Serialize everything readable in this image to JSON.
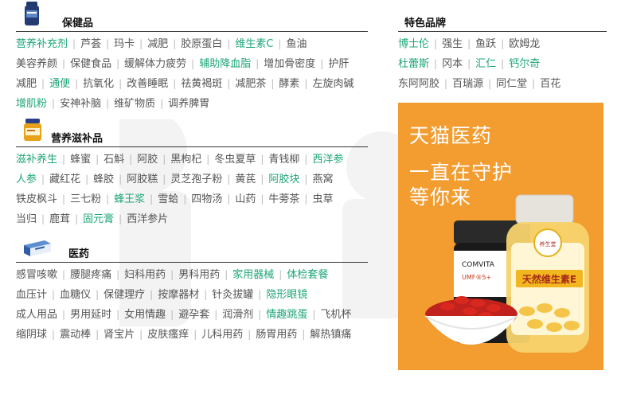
{
  "sections": [
    {
      "title": "保健品",
      "icon": "supplement-bottle-icon",
      "rows": [
        [
          {
            "t": "营养补充剂",
            "hl": true
          },
          {
            "t": "芦荟"
          },
          {
            "t": "玛卡"
          },
          {
            "t": "减肥"
          },
          {
            "t": "胶原蛋白"
          },
          {
            "t": "维生素C",
            "hl": true
          },
          {
            "t": "鱼油"
          }
        ],
        [
          {
            "t": "美容养颜"
          },
          {
            "t": "保健食品"
          },
          {
            "t": "缓解体力疲劳"
          },
          {
            "t": "辅助降血脂",
            "hl": true
          },
          {
            "t": "增加骨密度"
          },
          {
            "t": "护肝"
          }
        ],
        [
          {
            "t": "减肥"
          },
          {
            "t": "通便",
            "hl": true
          },
          {
            "t": "抗氧化"
          },
          {
            "t": "改善睡眠"
          },
          {
            "t": "祛黄褐斑"
          },
          {
            "t": "减肥茶"
          },
          {
            "t": "酵素"
          },
          {
            "t": "左旋肉碱"
          }
        ],
        [
          {
            "t": "增肌粉",
            "hl": true
          },
          {
            "t": "安神补脑"
          },
          {
            "t": "维矿物质"
          },
          {
            "t": "调养脾胃"
          }
        ]
      ]
    },
    {
      "title": "营养滋补品",
      "icon": "nutrition-jar-icon",
      "rows": [
        [
          {
            "t": "滋补养生",
            "hl": true
          },
          {
            "t": "蜂蜜"
          },
          {
            "t": "石斛"
          },
          {
            "t": "阿胶"
          },
          {
            "t": "黑枸杞"
          },
          {
            "t": "冬虫夏草"
          },
          {
            "t": "青钱柳"
          },
          {
            "t": "西洋参",
            "hl": true
          }
        ],
        [
          {
            "t": "人参",
            "hl": true
          },
          {
            "t": "藏红花"
          },
          {
            "t": "蜂胶"
          },
          {
            "t": "阿胶糕"
          },
          {
            "t": "灵芝孢子粉"
          },
          {
            "t": "黄芪"
          },
          {
            "t": "阿胶块",
            "hl": true
          },
          {
            "t": "燕窝"
          }
        ],
        [
          {
            "t": "铁皮枫斗"
          },
          {
            "t": "三七粉"
          },
          {
            "t": "蜂王浆",
            "hl": true
          },
          {
            "t": "雪蛤"
          },
          {
            "t": "四物汤"
          },
          {
            "t": "山药"
          },
          {
            "t": "牛蒡茶"
          },
          {
            "t": "虫草"
          }
        ],
        [
          {
            "t": "当归"
          },
          {
            "t": "鹿茸"
          },
          {
            "t": "固元膏",
            "hl": true
          },
          {
            "t": "西洋参片"
          }
        ]
      ]
    },
    {
      "title": "医药",
      "icon": "medicine-box-icon",
      "rows": [
        [
          {
            "t": "感冒咳嗽"
          },
          {
            "t": "腰腿疼痛"
          },
          {
            "t": "妇科用药"
          },
          {
            "t": "男科用药"
          },
          {
            "t": "家用器械",
            "hl": true
          },
          {
            "t": "体检套餐",
            "hl": true
          }
        ],
        [
          {
            "t": "血压计"
          },
          {
            "t": "血糖仪"
          },
          {
            "t": "保健理疗"
          },
          {
            "t": "按摩器材"
          },
          {
            "t": "针灸拔罐"
          },
          {
            "t": "隐形眼镜",
            "hl": true
          }
        ],
        [
          {
            "t": "成人用品"
          },
          {
            "t": "男用延时"
          },
          {
            "t": "女用情趣"
          },
          {
            "t": "避孕套"
          },
          {
            "t": "润滑剂"
          },
          {
            "t": "情趣跳蛋",
            "hl": true
          },
          {
            "t": "飞机杯"
          }
        ],
        [
          {
            "t": "缩阴球"
          },
          {
            "t": "震动棒"
          },
          {
            "t": "肾宝片"
          },
          {
            "t": "皮肤瘙痒"
          },
          {
            "t": "儿科用药"
          },
          {
            "t": "肠胃用药"
          },
          {
            "t": "解热镇痛"
          }
        ]
      ]
    }
  ],
  "brands": {
    "title": "特色品牌",
    "rows": [
      [
        {
          "t": "博士伦",
          "hl": true
        },
        {
          "t": "强生"
        },
        {
          "t": "鱼跃"
        },
        {
          "t": "欧姆龙"
        }
      ],
      [
        {
          "t": "杜蕾斯",
          "hl": true
        },
        {
          "t": "冈本"
        },
        {
          "t": "汇仁",
          "hl": true
        },
        {
          "t": "钙尔奇",
          "hl": true
        }
      ],
      [
        {
          "t": "东阿阿胶"
        },
        {
          "t": "百瑞源"
        },
        {
          "t": "同仁堂"
        },
        {
          "t": "百花"
        }
      ]
    ]
  },
  "banner": {
    "line1": "天猫医药",
    "line2a": "一直在守护",
    "line2b": "等你来",
    "background": "#f39c30",
    "jar_label_brand": "COMVITA",
    "jar_label_sub": "UMF®5+",
    "bottle_top_label": "养生堂",
    "bottle_label": "天然维生素E"
  },
  "colors": {
    "highlight": "#1da57a",
    "text": "#555555",
    "separator": "#bbbbbb"
  }
}
